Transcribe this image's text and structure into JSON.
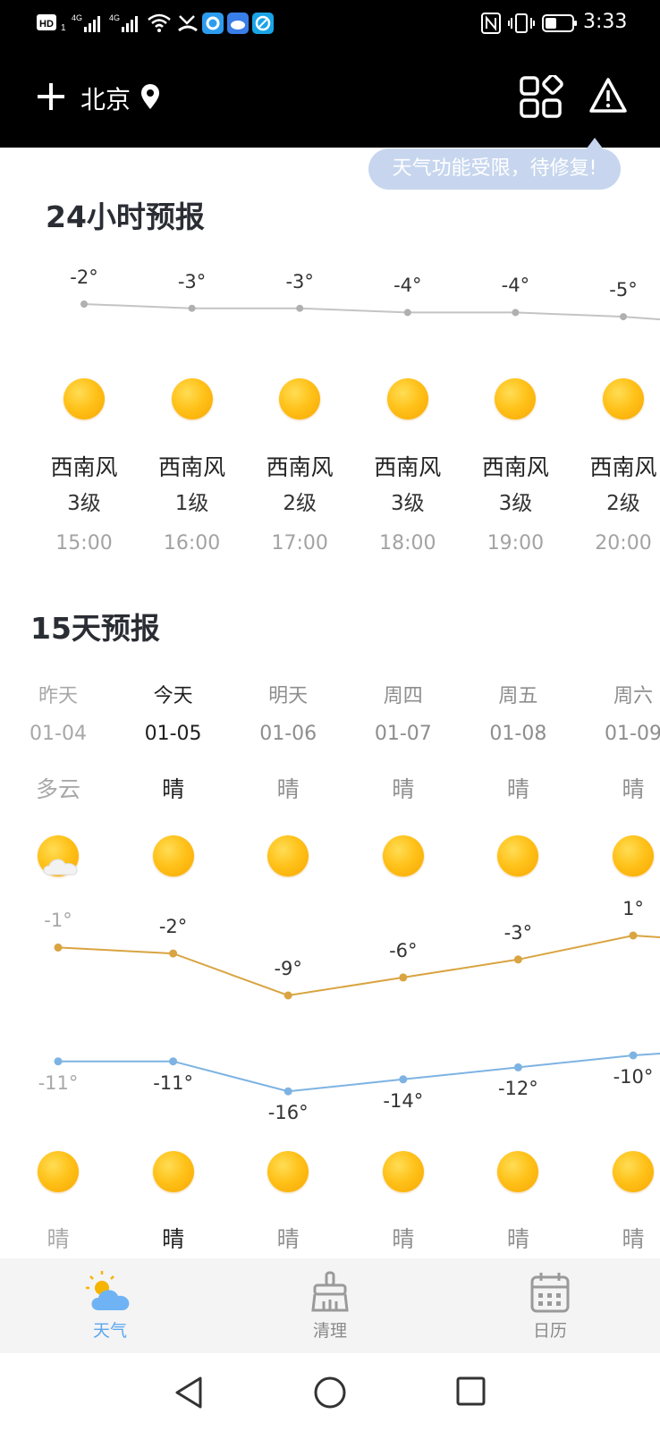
{
  "status_bar": {
    "time": "3:33",
    "left_icons": [
      "hd-icon",
      "signal-4g-icon",
      "signal-4g-icon",
      "wifi-icon",
      "missed-call-icon",
      "app-notification-icon",
      "weather-notification-icon",
      "browser-notification-icon"
    ],
    "right_icons": [
      "nfc-icon",
      "vibrate-icon",
      "battery-icon"
    ]
  },
  "header": {
    "city": "北京"
  },
  "toast": {
    "text": "天气功能受限，待修复!"
  },
  "hourly": {
    "title": "24小时预报",
    "items": [
      {
        "temp": "-2°",
        "value": -2,
        "wind": "西南风",
        "level": "3级",
        "time": "15:00"
      },
      {
        "temp": "-3°",
        "value": -3,
        "wind": "西南风",
        "level": "1级",
        "time": "16:00"
      },
      {
        "temp": "-3°",
        "value": -3,
        "wind": "西南风",
        "level": "2级",
        "time": "17:00"
      },
      {
        "temp": "-4°",
        "value": -4,
        "wind": "西南风",
        "level": "3级",
        "time": "18:00"
      },
      {
        "temp": "-4°",
        "value": -4,
        "wind": "西南风",
        "level": "3级",
        "time": "19:00"
      },
      {
        "temp": "-5°",
        "value": -5,
        "wind": "西南风",
        "level": "2级",
        "time": "20:00"
      }
    ]
  },
  "daily": {
    "title": "15天预报",
    "days": [
      {
        "day": "昨天",
        "date": "01-04",
        "day_cond": "多云",
        "high": "-1°",
        "high_value": -1,
        "low": "-11°",
        "low_value": -11,
        "night_cond": "晴",
        "state": "past"
      },
      {
        "day": "今天",
        "date": "01-05",
        "day_cond": "晴",
        "high": "-2°",
        "high_value": -2,
        "low": "-11°",
        "low_value": -11,
        "night_cond": "晴",
        "state": "today"
      },
      {
        "day": "明天",
        "date": "01-06",
        "day_cond": "晴",
        "high": "-9°",
        "high_value": -9,
        "low": "-16°",
        "low_value": -16,
        "night_cond": "晴",
        "state": "future"
      },
      {
        "day": "周四",
        "date": "01-07",
        "day_cond": "晴",
        "high": "-6°",
        "high_value": -6,
        "low": "-14°",
        "low_value": -14,
        "night_cond": "晴",
        "state": "future"
      },
      {
        "day": "周五",
        "date": "01-08",
        "day_cond": "晴",
        "high": "-3°",
        "high_value": -3,
        "low": "-12°",
        "low_value": -12,
        "night_cond": "晴",
        "state": "future"
      },
      {
        "day": "周六",
        "date": "01-09",
        "day_cond": "晴",
        "high": "1°",
        "high_value": 1,
        "low": "-10°",
        "low_value": -10,
        "night_cond": "晴",
        "state": "future"
      }
    ]
  },
  "tabs": [
    {
      "label": "天气",
      "icon": "weather-icon",
      "active": true
    },
    {
      "label": "清理",
      "icon": "broom-icon",
      "active": false
    },
    {
      "label": "日历",
      "icon": "calendar-icon",
      "active": false
    }
  ],
  "colors": {
    "accent": "#5aa6f0",
    "high_line": "#d9a441",
    "low_line": "#7db3e2",
    "hourly_line": "#c4c4c4",
    "inactive_tab": "#8a8a8a"
  }
}
